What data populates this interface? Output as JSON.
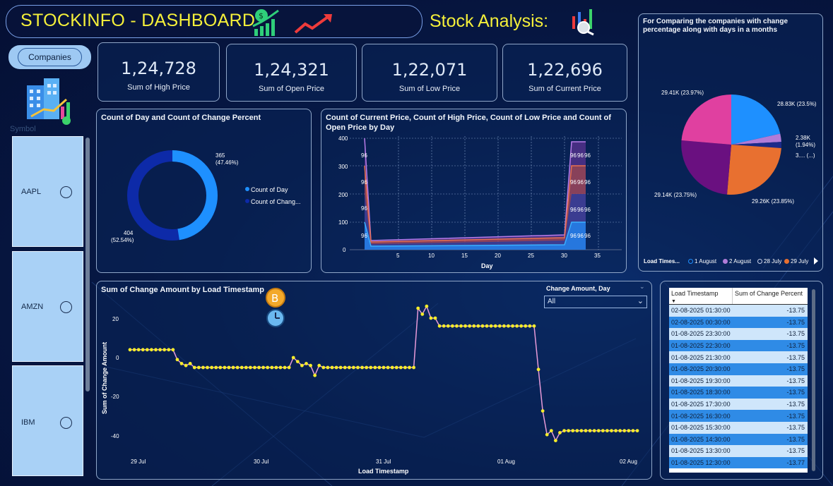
{
  "header": {
    "title": "STOCKINFO - DASHBOARD",
    "analysis_label": "Stock Analysis:"
  },
  "sidebar": {
    "companies_button": "Companies",
    "symbol_label": "Symbol",
    "items": [
      {
        "label": "AAPL"
      },
      {
        "label": "AMZN"
      },
      {
        "label": "IBM"
      }
    ]
  },
  "kpis": [
    {
      "value": "1,24,728",
      "label": "Sum of High Price"
    },
    {
      "value": "1,24,321",
      "label": "Sum of Open Price"
    },
    {
      "value": "1,22,071",
      "label": "Sum of Low Price"
    },
    {
      "value": "1,22,696",
      "label": "Sum of Current Price"
    }
  ],
  "donut": {
    "title": "Count of Day and Count of Change Percent",
    "label_a_value": "365",
    "label_a_pct": "(47.46%)",
    "label_b_value": "404",
    "label_b_pct": "(52.54%)",
    "legend": [
      "Count of Day",
      "Count of Chang..."
    ],
    "colors": [
      "#1e90ff",
      "#0d2aa8"
    ]
  },
  "area_chart": {
    "title": "Count of Current Price, Count of High Price, Count of Low Price and Count of Open Price by Day",
    "xlabel": "Day",
    "yticks": [
      "400",
      "300",
      "200",
      "100",
      "0"
    ],
    "xticks": [
      "5",
      "10",
      "15",
      "20",
      "25",
      "30",
      "35"
    ],
    "data_label": "96"
  },
  "pie": {
    "title": "For Comparing the companies with change percentage along with days in a months",
    "labels": [
      "29.41K (23.97%)",
      "28.83K (23.5%)",
      "2.38K",
      "(1.94%)",
      "3.... (...)",
      "29.14K (23.75%)",
      "29.26K (23.85%)"
    ],
    "legend_title": "Load Times...",
    "legend": [
      "1 August",
      "2 August",
      "28 July",
      "29 July"
    ],
    "legend_colors": [
      "#1e90ff",
      "#b07cd8",
      "#1b2a8a",
      "#e87030"
    ]
  },
  "line_chart": {
    "title": "Sum of Change Amount by Load Timestamp",
    "filter_title": "Change Amount, Day",
    "filter_value": "All",
    "xlabel": "Load Timestamp",
    "ylabel": "Sum of Change Amount",
    "yticks": [
      "20",
      "0",
      "-20",
      "-40"
    ],
    "xticks": [
      "29 Jul",
      "30 Jul",
      "31 Jul",
      "01 Aug",
      "02 Aug"
    ]
  },
  "table": {
    "headers": [
      "Load Timestamp",
      "Sum of Change Percent"
    ],
    "rows": [
      [
        "02-08-2025 01:30:00",
        "-13.75"
      ],
      [
        "02-08-2025 00:30:00",
        "-13.75"
      ],
      [
        "01-08-2025 23:30:00",
        "-13.75"
      ],
      [
        "01-08-2025 22:30:00",
        "-13.75"
      ],
      [
        "01-08-2025 21:30:00",
        "-13.75"
      ],
      [
        "01-08-2025 20:30:00",
        "-13.75"
      ],
      [
        "01-08-2025 19:30:00",
        "-13.75"
      ],
      [
        "01-08-2025 18:30:00",
        "-13.75"
      ],
      [
        "01-08-2025 17:30:00",
        "-13.75"
      ],
      [
        "01-08-2025 16:30:00",
        "-13.75"
      ],
      [
        "01-08-2025 15:30:00",
        "-13.75"
      ],
      [
        "01-08-2025 14:30:00",
        "-13.75"
      ],
      [
        "01-08-2025 13:30:00",
        "-13.75"
      ],
      [
        "01-08-2025 12:30:00",
        "-13.77"
      ]
    ]
  }
}
